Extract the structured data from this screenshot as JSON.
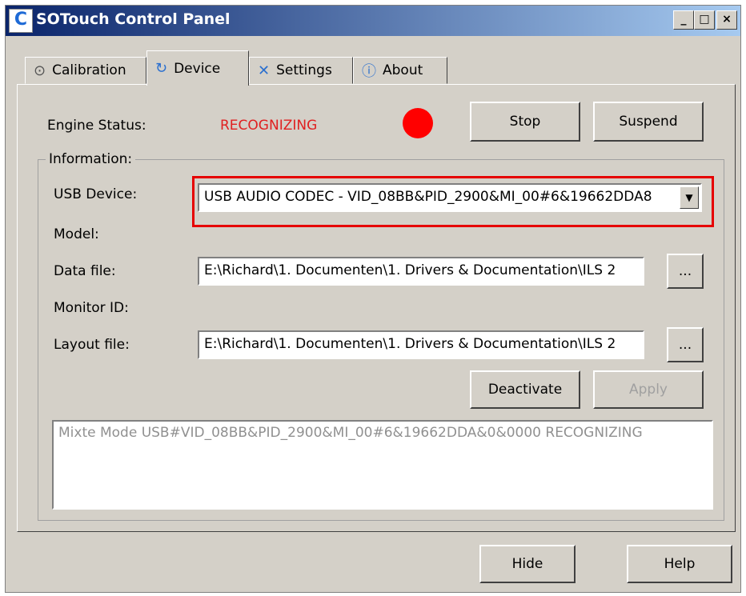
{
  "window": {
    "title": "SOTouch Control Panel",
    "app_icon": "C"
  },
  "titlebar_buttons": {
    "minimize": "_",
    "maximize": "□",
    "close": "×"
  },
  "tabs": [
    {
      "label": "Calibration",
      "icon": "target-icon"
    },
    {
      "label": "Device",
      "icon": "refresh-icon",
      "active": true
    },
    {
      "label": "Settings",
      "icon": "tools-icon"
    },
    {
      "label": "About",
      "icon": "info-icon"
    }
  ],
  "engine": {
    "label": "Engine Status:",
    "status": "RECOGNIZING",
    "status_color": "#e02020",
    "indicator_color": "#ff0000"
  },
  "buttons": {
    "stop": "Stop",
    "suspend": "Suspend",
    "browse": "...",
    "deactivate": "Deactivate",
    "apply": "Apply",
    "hide": "Hide",
    "help": "Help"
  },
  "information": {
    "legend": "Information:",
    "usb_device_label": "USB Device:",
    "usb_device_value": "USB AUDIO CODEC - VID_08BB&PID_2900&MI_00#6&19662DDA8",
    "model_label": "Model:",
    "data_file_label": "Data file:",
    "data_file_value": "E:\\Richard\\1. Documenten\\1. Drivers & Documentation\\ILS 2",
    "monitor_id_label": "Monitor ID:",
    "layout_file_label": "Layout file:",
    "layout_file_value": "E:\\Richard\\1. Documenten\\1. Drivers & Documentation\\ILS 2"
  },
  "log": {
    "text": "Mixte Mode USB#VID_08BB&PID_2900&MI_00#6&19662DDA&0&0000 RECOGNIZING"
  }
}
